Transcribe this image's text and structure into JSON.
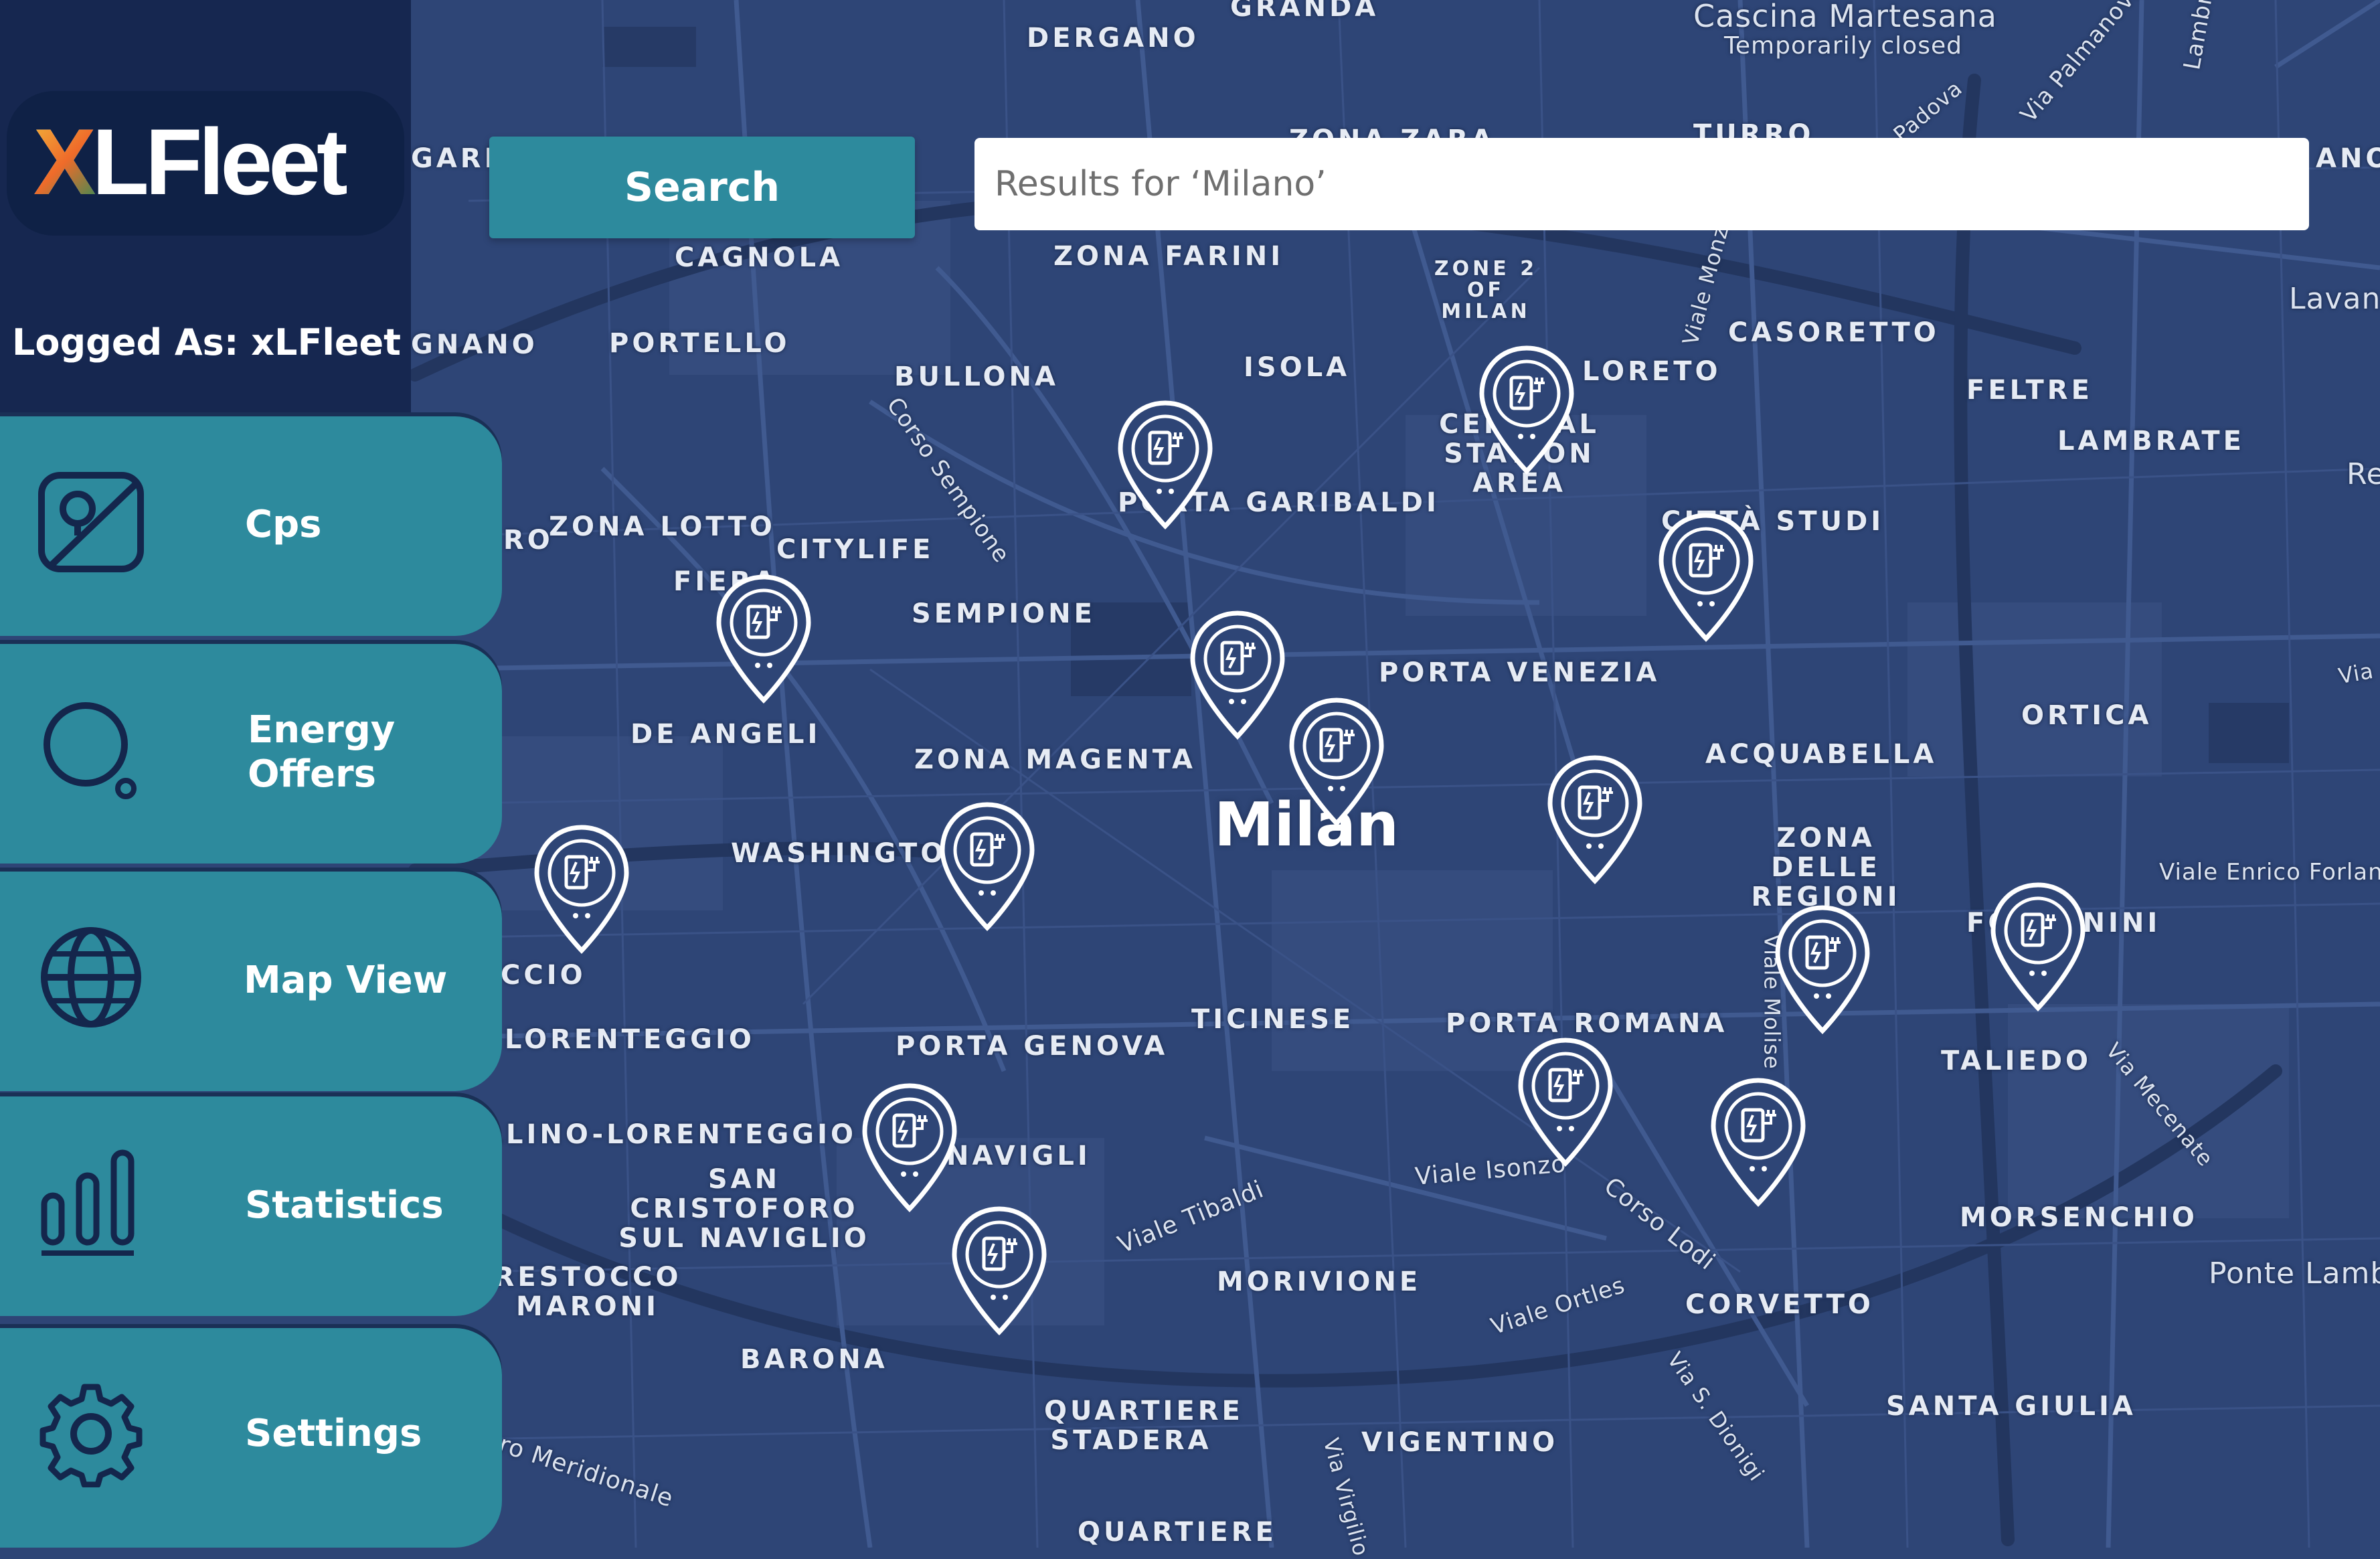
{
  "app": {
    "logo_text": "XLFleet",
    "logo_x": "X"
  },
  "user": {
    "logged_as_label": "Logged As: xLFleet"
  },
  "search": {
    "button_label": "Search",
    "placeholder": "Results for ‘Milano’"
  },
  "nav": [
    {
      "label": "Cps",
      "icon": "map-image-icon"
    },
    {
      "label": "Energy Offers",
      "icon": "energy-search-icon"
    },
    {
      "label": "Map View",
      "icon": "globe-icon"
    },
    {
      "label": "Statistics",
      "icon": "bar-chart-icon"
    },
    {
      "label": "Settings",
      "icon": "gear-icon"
    }
  ],
  "map": {
    "city_label": "Milan",
    "district_labels": [
      "DERGANO",
      "GRANDA",
      "ZONA ZARA",
      "TURRO",
      "CAGNOLA",
      "ZONA FARINI",
      "ZONE 2 OF MILAN",
      "CASORETTO",
      "FELTRE",
      "PORTELLO",
      "BULLONA",
      "ISOLA",
      "LORETO",
      "CENTRAL STATION AREA",
      "LAMBRATE",
      "PORTA GARIBALDI",
      "ZONA LOTTO",
      "CITYLIFE",
      "FIERA",
      "CITTÀ STUDI",
      "SEMPIONE",
      "PORTA VENEZIA",
      "ORTICA",
      "DE ANGELI",
      "ZONA MAGENTA",
      "ACQUABELLA",
      "WASHINGTON",
      "ZONA DELLE REGIONI",
      "FORLANINI",
      "LORENTEGGIO",
      "TICINESE",
      "PORTA ROMANA",
      "TALIEDO",
      "PORTA GENOVA",
      "GIAMBELLINO-LORENTEGGIO",
      "SAN CRISTOFORO SUL NAVIGLIO",
      "NAVIGLI",
      "MORSENCHIO",
      "RESTOCCO MARONI",
      "MORIVIONE",
      "CORVETTO",
      "BARONA",
      "SANTA GIULIA",
      "QUARTIERE STADERA",
      "VIGENTINO",
      "QUARTIERE",
      "GARE",
      "GNANO",
      "RO",
      "CCIO",
      "ANO"
    ],
    "street_labels": [
      "Cascina Martesana",
      "Temporarily closed",
      "Via Palmanova",
      "Corso Sempione",
      "Viale Monza",
      "Lambro",
      "Padova",
      "Lavan",
      "Re",
      "Via",
      "Viale Enrico Forlanini",
      "Viale Molise",
      "Viale Isonzo",
      "Corso Lodi",
      "Viale Tibaldi",
      "Viale Ortles",
      "Via S. Dionigi",
      "Via Mecenate",
      "Ponte Lamb",
      "Via Virgilio",
      "ro Meridionale",
      "Ponte Lambro"
    ],
    "charging_station_count": 15
  },
  "colors": {
    "map_bg": "#2e4576",
    "sidebar_dark": "#162750",
    "accent_teal": "#2d8a9d",
    "text_white": "#ffffff"
  }
}
